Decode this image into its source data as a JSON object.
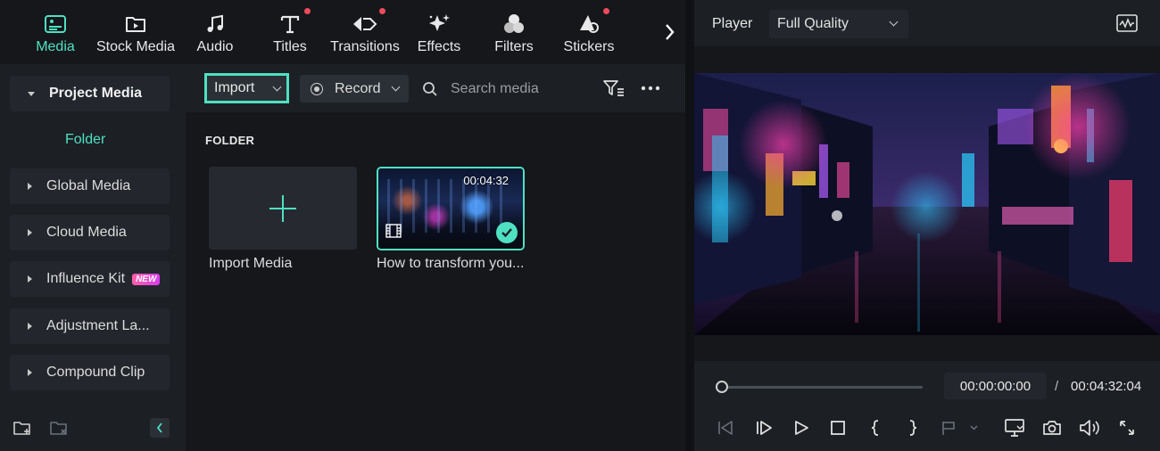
{
  "colors": {
    "accent": "#4fe0c2",
    "notify_dot": "#ef4b5b",
    "panel": "#1c1f24",
    "panel_dark": "#15171b"
  },
  "tabs": [
    {
      "label": "Media",
      "icon": "media-icon",
      "active": true,
      "dot": false
    },
    {
      "label": "Stock Media",
      "icon": "stock-media-icon",
      "active": false,
      "dot": false
    },
    {
      "label": "Audio",
      "icon": "music-note-icon",
      "active": false,
      "dot": false
    },
    {
      "label": "Titles",
      "icon": "text-t-icon",
      "active": false,
      "dot": true
    },
    {
      "label": "Transitions",
      "icon": "transitions-icon",
      "active": false,
      "dot": true
    },
    {
      "label": "Effects",
      "icon": "sparkle-icon",
      "active": false,
      "dot": false
    },
    {
      "label": "Filters",
      "icon": "filters-icon",
      "active": false,
      "dot": false
    },
    {
      "label": "Stickers",
      "icon": "stickers-icon",
      "active": false,
      "dot": true
    }
  ],
  "sidebar": {
    "items": [
      {
        "label": "Project Media",
        "expanded": true
      },
      {
        "label": "Global Media",
        "expanded": false
      },
      {
        "label": "Cloud Media",
        "expanded": false
      },
      {
        "label": "Influence Kit",
        "expanded": false,
        "badge": "NEW"
      },
      {
        "label": "Adjustment La...",
        "expanded": false
      },
      {
        "label": "Compound Clip",
        "expanded": false
      }
    ],
    "folder_label": "Folder"
  },
  "toolbar": {
    "import_label": "Import",
    "record_label": "Record",
    "search_placeholder": "Search media"
  },
  "media": {
    "section_title": "FOLDER",
    "import_tile_label": "Import Media",
    "clip": {
      "title": "How to transform you...",
      "duration": "00:04:32",
      "selected": true
    }
  },
  "player": {
    "title": "Player",
    "quality": "Full Quality",
    "current_time": "00:00:00:00",
    "separator": "/",
    "total_time": "00:04:32:04",
    "progress": 0
  }
}
